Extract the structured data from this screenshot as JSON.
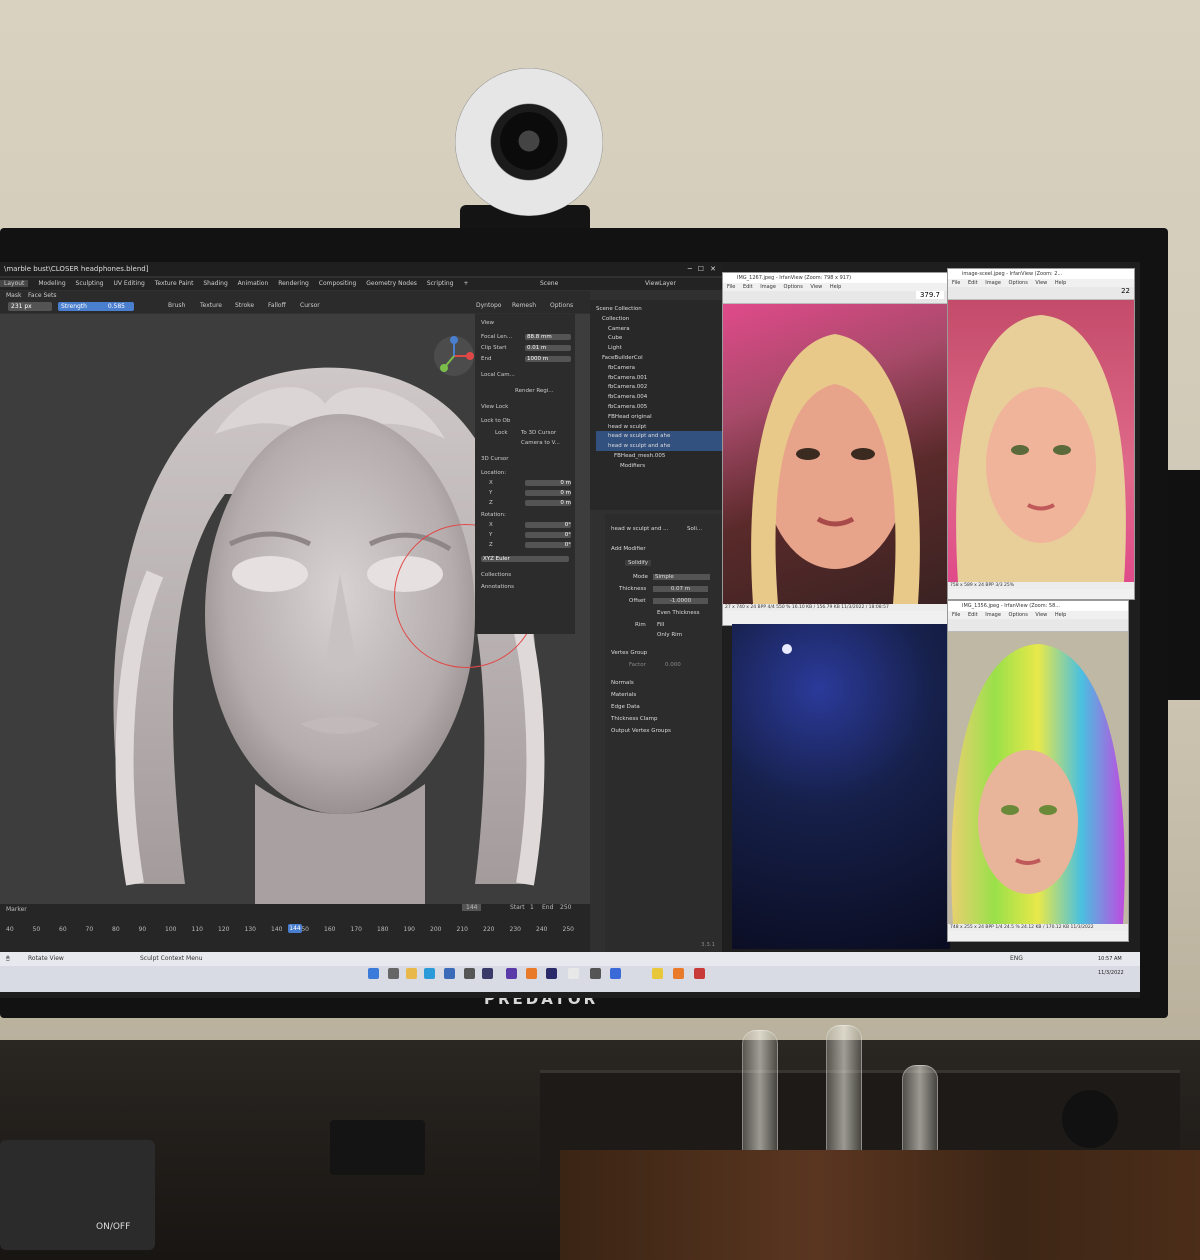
{
  "blender": {
    "title_path": "\\marble bust\\CLOSER headphones.blend]",
    "menus": [
      "Layout",
      "Modeling",
      "Sculpting",
      "UV Editing",
      "Texture Paint",
      "Shading",
      "Animation",
      "Rendering",
      "Compositing",
      "Geometry Nodes",
      "Scripting",
      "+"
    ],
    "header_tabs": [
      "Mask",
      "Face Sets"
    ],
    "scene_label": "Scene",
    "viewlayer_label": "ViewLayer",
    "toolbar": {
      "radius": "231 px",
      "strength_label": "Strength",
      "strength": "0.585",
      "brush": "Brush",
      "texture": "Texture",
      "stroke": "Stroke",
      "falloff": "Falloff",
      "cursor": "Cursor",
      "dyntopo": "Dyntopo",
      "remesh": "Remesh",
      "options": "Options"
    },
    "n_panel": {
      "view_header": "View",
      "focal_label": "Focal Len...",
      "focal": "88.8 mm",
      "clip_start_label": "Clip Start",
      "clip_start": "0.01 m",
      "end_label": "End",
      "end": "1000 m",
      "local_cam": "Local Cam...",
      "render_region": "Render Regi...",
      "view_lock": "View Lock",
      "lock_to_ob": "Lock to Ob",
      "lock": "Lock",
      "to_3d_cursor": "To 3D Cursor",
      "camera_to_view": "Camera to V...",
      "cursor_header": "3D Cursor",
      "location": "Location:",
      "rotation": "Rotation:",
      "x": "X",
      "y": "Y",
      "z": "Z",
      "zero_m": "0 m",
      "zero_deg": "0°",
      "rot_mode": "XYZ Euler",
      "collections": "Collections",
      "annotations": "Annotations"
    },
    "outliner": {
      "rows": [
        "Scene Collection",
        "Collection",
        "Camera",
        "Cube",
        "Light",
        "FaceBuilderCol",
        "fbCamera",
        "fbCamera.001",
        "fbCamera.002",
        "fbCamera.004",
        "fbCamera.005",
        "FBHead original",
        "head w sculpt",
        "head w sculpt and ahe",
        "head w sculpt and ahe",
        "FBHead_mesh.005",
        "Modifiers"
      ]
    },
    "properties": {
      "breadcrumb": "head w sculpt and ...",
      "breadcrumb2": "Soli...",
      "add_modifier": "Add Modifier",
      "modifier": "Solidify",
      "mode_label": "Mode",
      "mode": "Simple",
      "thickness_label": "Thickness",
      "thickness": "0.07 m",
      "offset_label": "Offset",
      "offset": "-1.0000",
      "even_thickness": "Even Thickness",
      "rim_label": "Rim",
      "fill": "Fill",
      "only_rim": "Only Rim",
      "vertex_group": "Vertex Group",
      "factor_label": "Factor",
      "factor": "0.000",
      "sections": [
        "Normals",
        "Materials",
        "Edge Data",
        "Thickness Clamp",
        "Output Vertex Groups"
      ],
      "version": "3.3.1"
    },
    "timeline": {
      "marker": "Marker",
      "current": "144",
      "start_label": "Start",
      "start": "1",
      "end_label": "End",
      "end": "250",
      "ticks": [
        "40",
        "50",
        "60",
        "70",
        "80",
        "90",
        "100",
        "110",
        "120",
        "130",
        "140",
        "150",
        "160",
        "170",
        "180",
        "190",
        "200",
        "210",
        "220",
        "230",
        "240",
        "250"
      ]
    },
    "status": {
      "left": "Rotate View",
      "middle": "Sculpt Context Menu"
    }
  },
  "viewers": [
    {
      "title": "IMG_1267.jpeg - IrfanView (Zoom: 798 x 917)",
      "menu": [
        "File",
        "Edit",
        "Image",
        "Options",
        "View",
        "Help"
      ],
      "zoom": "379.7",
      "status": "27 x 740 x 24 BPP   4/4   550 %   16.10 KB / 156.79 KB   11/3/2022 / 18:08:57"
    },
    {
      "title": "image-sceel.jpeg - IrfanView (Zoom: 2...",
      "menu": [
        "File",
        "Edit",
        "Image",
        "Options",
        "View",
        "Help"
      ],
      "zoom": "22",
      "status": "758 x 589 x 24 BPP   3/3   25%"
    },
    {
      "title": "IMG_1356.jpeg - IrfanView (Zoom: 58...",
      "menu": [
        "File",
        "Edit",
        "Image",
        "Options",
        "View",
        "Help"
      ],
      "zoom": "",
      "status": "748 x 255 x 24 BPP   1/4   24.5 %   24.12 KB / 170.12 KB   11/3/2022"
    }
  ],
  "taskbar": {
    "clock_time": "10:57 AM",
    "clock_date": "11/3/2022",
    "lang": "ENG"
  },
  "monitor_brand": "PREDATOR",
  "usb_hub_label": "ON/OFF",
  "colors": {
    "accent_blue": "#4a7fcf",
    "brush_red": "#e04848",
    "taskbar": "#d9dbe4"
  }
}
